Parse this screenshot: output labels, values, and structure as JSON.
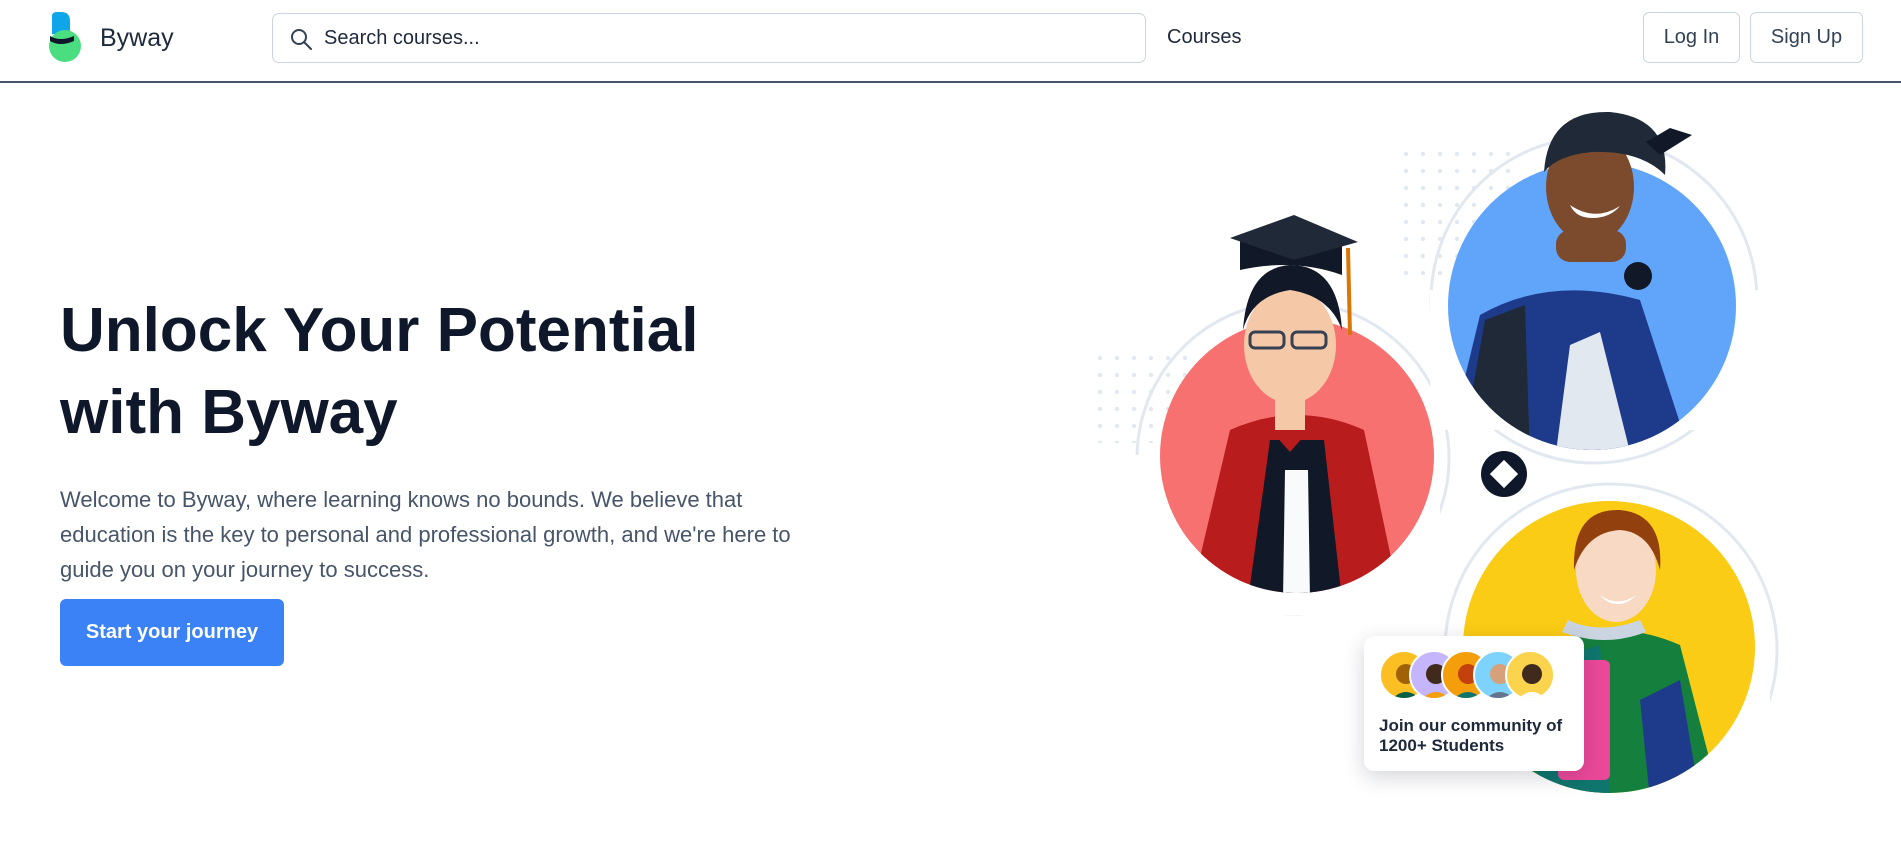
{
  "header": {
    "brand": "Byway",
    "search_placeholder": "Search courses...",
    "nav_courses": "Courses",
    "login_label": "Log In",
    "signup_label": "Sign Up"
  },
  "hero": {
    "title_line1": "Unlock Your Potential",
    "title_line2": "with Byway",
    "description": "Welcome to Byway, where learning knows no bounds. We believe that education is the key to personal and professional growth, and we're here to guide you on your journey to success.",
    "cta_label": "Start your journey"
  },
  "community": {
    "line1": "Join our community of",
    "line2": "1200+ Students"
  },
  "colors": {
    "accent": "#3b82f6",
    "circle_red": "#f87171",
    "circle_blue": "#60a5fa",
    "circle_yellow": "#facc15",
    "logo_blue": "#0ea5e9",
    "logo_green": "#4ade80"
  },
  "icons": [
    "logo-icon",
    "search-icon",
    "diamond-icon"
  ]
}
